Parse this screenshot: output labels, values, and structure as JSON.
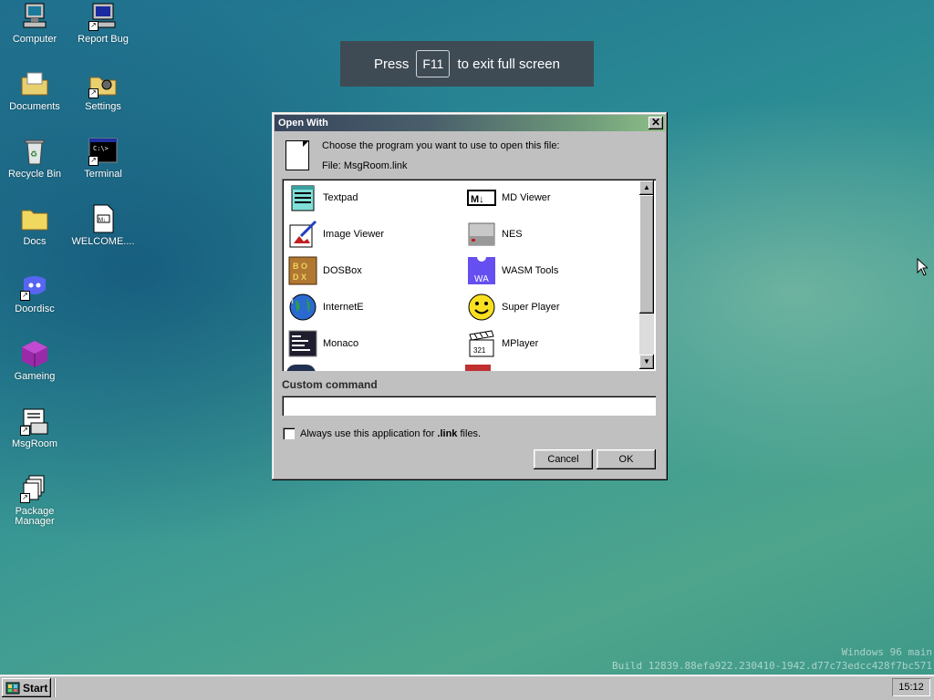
{
  "desktop": {
    "icons": [
      {
        "label": "Computer",
        "icon": "computer-icon"
      },
      {
        "label": "Report Bug",
        "icon": "report-bug-icon"
      },
      {
        "label": "Documents",
        "icon": "documents-folder-icon"
      },
      {
        "label": "Settings",
        "icon": "settings-folder-icon"
      },
      {
        "label": "Recycle Bin",
        "icon": "recycle-bin-icon"
      },
      {
        "label": "Terminal",
        "icon": "terminal-icon"
      },
      {
        "label": "Docs",
        "icon": "folder-icon"
      },
      {
        "label": "WELCOME....",
        "icon": "markdown-file-icon"
      },
      {
        "label": "Doordisc",
        "icon": "doordisc-icon"
      },
      {
        "label": "Gameing",
        "icon": "cube-icon"
      },
      {
        "label": "MsgRoom",
        "icon": "msgroom-icon"
      },
      {
        "label": "Package Manager",
        "icon": "package-manager-icon"
      }
    ]
  },
  "toast": {
    "before": "Press",
    "key": "F11",
    "after": "to exit full screen"
  },
  "dialog": {
    "title": "Open With",
    "close_glyph": "✕",
    "prompt": "Choose the program you want to use to open this file:",
    "file_line": "File: MsgRoom.link",
    "programs": [
      {
        "label": "Textpad",
        "icon": "notepad-icon"
      },
      {
        "label": "MD Viewer",
        "icon": "markdown-viewer-icon"
      },
      {
        "label": "Image Viewer",
        "icon": "image-viewer-icon"
      },
      {
        "label": "NES",
        "icon": "nes-icon"
      },
      {
        "label": "DOSBox",
        "icon": "dosbox-icon"
      },
      {
        "label": "WASM Tools",
        "icon": "wasm-icon"
      },
      {
        "label": "InternetE",
        "icon": "globe-icon"
      },
      {
        "label": "Super Player",
        "icon": "smiley-icon"
      },
      {
        "label": "Monaco",
        "icon": "monaco-editor-icon"
      },
      {
        "label": "MPlayer",
        "icon": "clapperboard-icon"
      }
    ],
    "custom_command_label": "Custom command",
    "custom_command_value": "",
    "always_use_prefix": "Always use this application for ",
    "always_use_ext": ".link",
    "always_use_suffix": " files.",
    "always_use_checked": false,
    "cancel_label": "Cancel",
    "ok_label": "OK"
  },
  "watermark": {
    "line1": "Windows 96 main",
    "line2": "Build 12839.88efa922.230410-1942.d77c73edcc428f7bc571"
  },
  "taskbar": {
    "start_label": "Start",
    "clock": "15:12"
  }
}
